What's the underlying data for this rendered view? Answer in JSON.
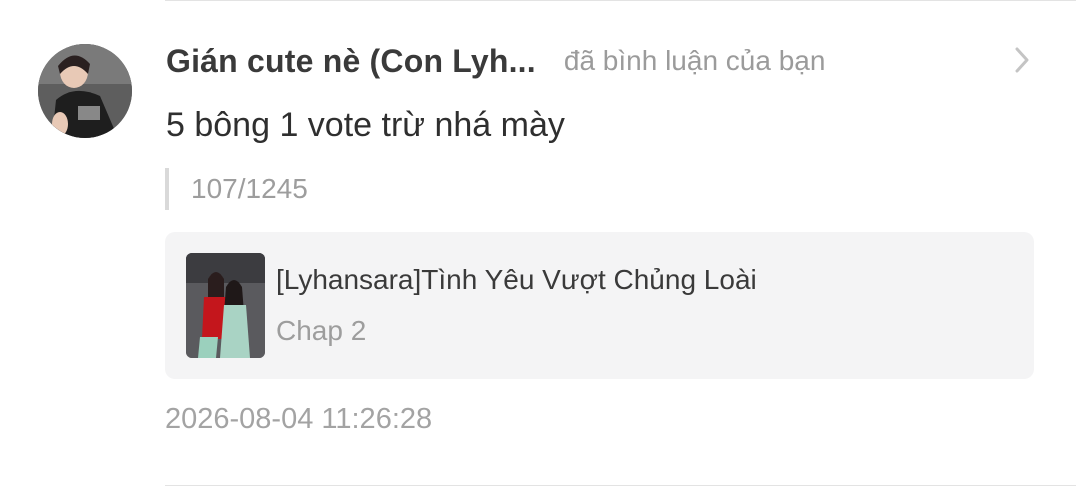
{
  "notification": {
    "author_name": "Gián cute nè (Con Lyh...",
    "action_text": "đã bình luận của bạn",
    "comment_text": "5 bông 1 vote trừ nhá mày",
    "quoted_text": "107/1245",
    "story": {
      "title": "[Lyhansara]Tình Yêu Vượt Chủng Loài",
      "chapter": "Chap 2"
    },
    "timestamp": "2026-08-04 11:26:28",
    "avatar_icon": "user-avatar-photo",
    "chevron_icon": "chevron-right-icon"
  },
  "colors": {
    "background": "#ffffff",
    "name_text": "#3a3a3a",
    "secondary_text": "#9b9b9b",
    "card_background": "#f4f4f5",
    "divider": "#e3e3e3"
  }
}
